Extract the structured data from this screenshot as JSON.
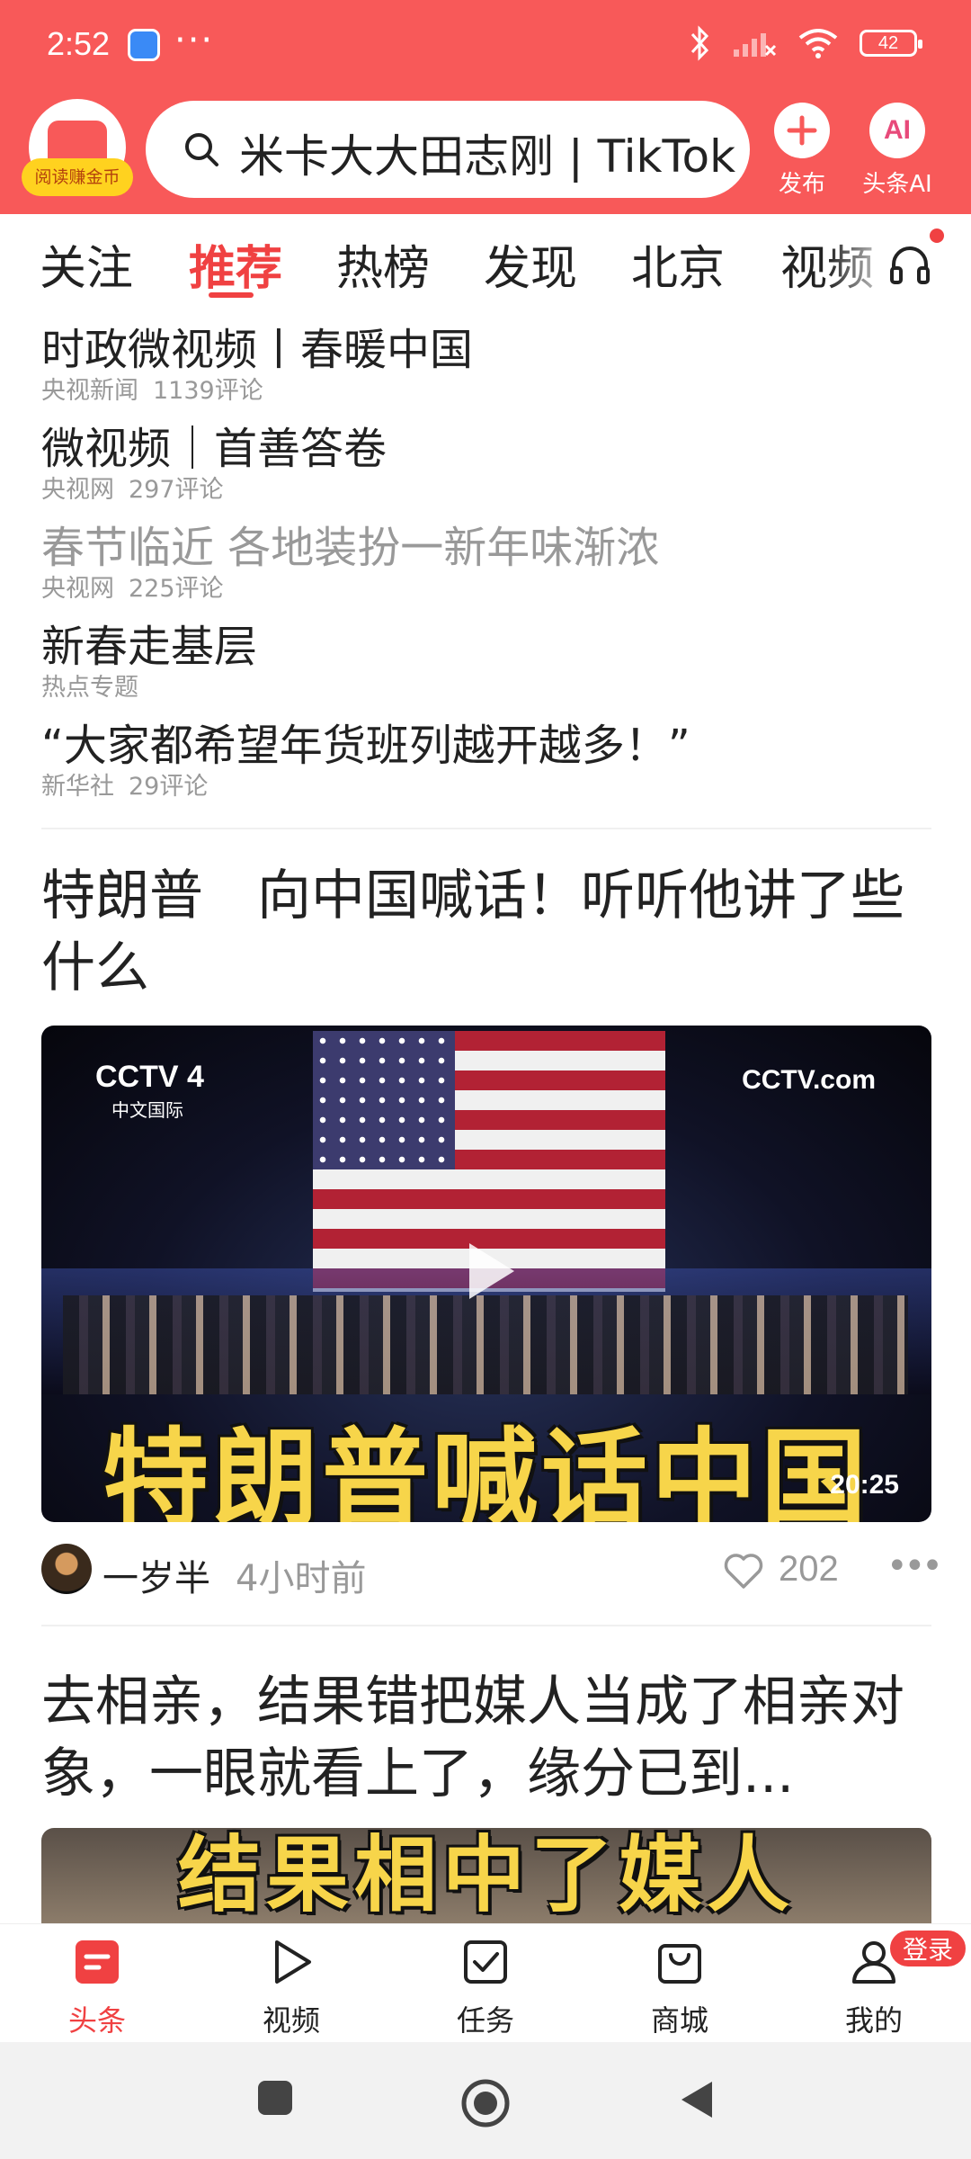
{
  "status_bar": {
    "time": "2:52",
    "dots": "···",
    "battery": "42"
  },
  "header": {
    "logo_badge": "阅读赚金币",
    "search_text": "米卡大大田志刚 | TikTok",
    "publish_label": "发布",
    "ai_label": "头条AI",
    "ai_glyph": "AI"
  },
  "tabs": [
    {
      "label": "关注"
    },
    {
      "label": "推荐",
      "active": true
    },
    {
      "label": "热榜"
    },
    {
      "label": "发现"
    },
    {
      "label": "北京"
    },
    {
      "label": "视频"
    }
  ],
  "news_list": [
    {
      "title": "时政微视频丨春暖中国",
      "source": "央视新闻",
      "comments": "1139评论",
      "read": false
    },
    {
      "title": "微视频｜首善答卷",
      "source": "央视网",
      "comments": "297评论",
      "read": false
    },
    {
      "title": "春节临近 各地装扮一新年味渐浓",
      "source": "央视网",
      "comments": "225评论",
      "read": true
    },
    {
      "title": "新春走基层",
      "source": "热点专题",
      "comments": "",
      "read": false
    },
    {
      "title": "“大家都希望年货班列越开越多！”",
      "source": "新华社",
      "comments": "29评论",
      "read": false
    }
  ],
  "article1": {
    "title": "特朗普　向中国喊话！听听他讲了些什么",
    "video_caption": "特朗普喊话中国",
    "channel_logo": "CCTV 4",
    "channel_sub": "中文国际",
    "watermark": "CCTV.com",
    "duration": "20:25",
    "author": "一岁半",
    "time": "4小时前",
    "likes": "202"
  },
  "article2": {
    "title": "去相亲，结果错把媒人当成了相亲对象，一眼就看上了，缘分已到...",
    "video_caption": "结果相中了媒人"
  },
  "bottom_tabs": [
    {
      "label": "头条",
      "icon": "headline-icon",
      "active": true
    },
    {
      "label": "视频",
      "icon": "video-play-icon"
    },
    {
      "label": "任务",
      "icon": "task-check-icon"
    },
    {
      "label": "商城",
      "icon": "shopping-bag-icon"
    },
    {
      "label": "我的",
      "icon": "profile-icon"
    }
  ],
  "login_badge": "登录",
  "colors": {
    "brand_red": "#f85959",
    "accent_red": "#f04142",
    "muted_text": "#999999",
    "caption_yellow": "#f7d54a"
  }
}
